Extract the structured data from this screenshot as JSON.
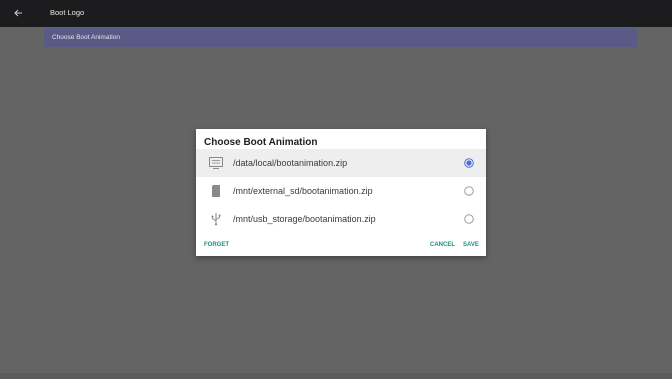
{
  "app_bar": {
    "title": "Boot Logo",
    "back_icon": "arrow-back-icon"
  },
  "preference": {
    "label": "Choose Boot Animation"
  },
  "dialog": {
    "title": "Choose Boot Animation",
    "options": [
      {
        "label": "/data/local/bootanimation.zip",
        "icon": "storage-drive-icon",
        "selected": true
      },
      {
        "label": "/mnt/external_sd/bootanimation.zip",
        "icon": "sd-card-icon",
        "selected": false
      },
      {
        "label": "/mnt/usb_storage/bootanimation.zip",
        "icon": "usb-icon",
        "selected": false
      }
    ],
    "buttons": {
      "forget": "FORGET",
      "cancel": "CANCEL",
      "save": "SAVE"
    }
  },
  "colors": {
    "accent": "#1b8f84",
    "radio_selected": "#4f6fd8",
    "subbar": "#595b86",
    "topbar": "#1c1c1e",
    "background": "#646464"
  }
}
